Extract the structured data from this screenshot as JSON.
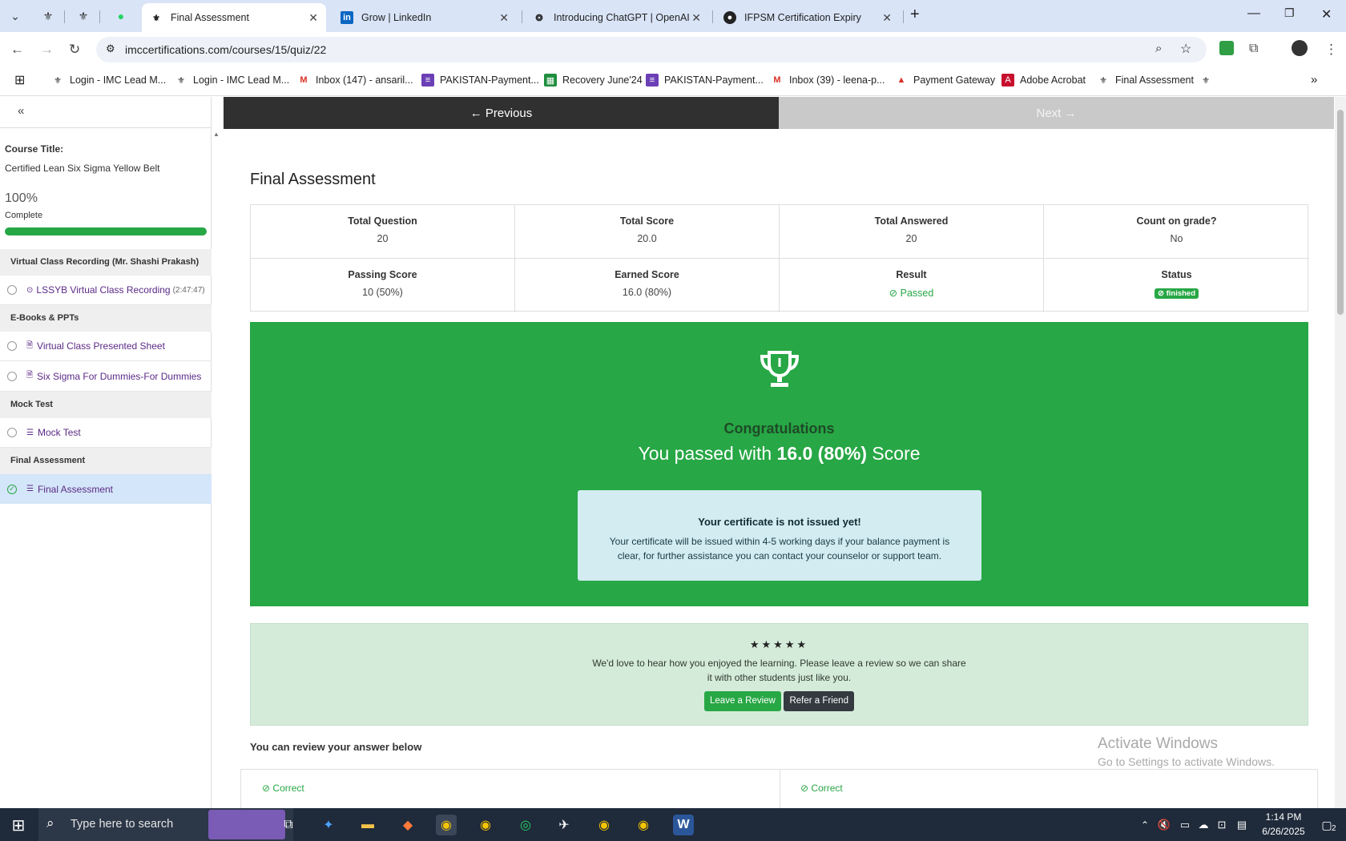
{
  "tabs": [
    {
      "label": "Final Assessment",
      "active": true
    },
    {
      "label": "Grow | LinkedIn"
    },
    {
      "label": "Introducing ChatGPT | OpenAI"
    },
    {
      "label": "IFPSM Certification Expiry"
    }
  ],
  "address": {
    "url": "imccertifications.com/courses/15/quiz/22"
  },
  "bookmarks": [
    "Login - IMC Lead M...",
    "Login - IMC Lead M...",
    "Inbox (147) - ansaril...",
    "PAKISTAN-Payment...",
    "Recovery June'24",
    "PAKISTAN-Payment...",
    "Inbox (39) - leena-p...",
    "Payment Gateway",
    "Adobe Acrobat",
    "Final Assessment"
  ],
  "sidebar": {
    "course_title_label": "Course Title:",
    "course_title": "Certified Lean Six Sigma Yellow Belt",
    "progress_value": "100%",
    "progress_label": "Complete",
    "progress_fraction": 1.0,
    "sections": [
      {
        "title": "Virtual Class Recording (Mr. Shashi Prakash)",
        "items": [
          {
            "label": "LSSYB Virtual Class Recording",
            "duration": "(2:47:47)"
          }
        ]
      },
      {
        "title": "E-Books & PPTs",
        "items": [
          {
            "label": "Virtual Class Presented Sheet"
          },
          {
            "label": "Six Sigma For Dummies-For Dummies"
          }
        ]
      },
      {
        "title": "Mock Test",
        "items": [
          {
            "label": "Mock Test"
          }
        ]
      },
      {
        "title": "Final Assessment",
        "items": [
          {
            "label": "Final Assessment"
          }
        ]
      }
    ]
  },
  "nav": {
    "previous": "← Previous",
    "next": "Next →"
  },
  "page_title": "Final Assessment",
  "stats": {
    "total_question": {
      "label": "Total Question",
      "value": "20"
    },
    "total_score": {
      "label": "Total Score",
      "value": "20.0"
    },
    "total_answered": {
      "label": "Total Answered",
      "value": "20"
    },
    "count_on_grade": {
      "label": "Count on grade?",
      "value": "No"
    },
    "passing_score": {
      "label": "Passing Score",
      "value": "10 (50%)"
    },
    "earned_score": {
      "label": "Earned Score",
      "value": "16.0 (80%)"
    },
    "result": {
      "label": "Result",
      "value": "Passed"
    },
    "status": {
      "label": "Status",
      "value": "finished"
    }
  },
  "congrats": {
    "heading": "Congratulations",
    "line_pre": "You passed with ",
    "line_score": "16.0 (80%)",
    "line_post": " Score",
    "cert_title": "Your certificate is not issued yet!",
    "cert_text": "Your certificate will be issued within 4-5 working days if your balance payment is clear, for further assistance you can contact your counselor or support team."
  },
  "review": {
    "stars": 5,
    "text": "We'd love to hear how you enjoyed the learning. Please leave a review so we can share it with other students just like you.",
    "leave_review": "Leave a Review",
    "refer_friend": "Refer a Friend"
  },
  "answers": {
    "heading": "You can review your answer below",
    "left_status": "Correct",
    "right_status": "Correct"
  },
  "watermark": {
    "title": "Activate Windows",
    "subtitle": "Go to Settings to activate Windows."
  },
  "taskbar": {
    "search_placeholder": "Type here to search",
    "time": "1:14 PM",
    "date": "6/26/2025",
    "notif_count": "2"
  },
  "colors": {
    "green": "#27a745",
    "dark": "#303030",
    "sidebar_active": "#d4e6f9"
  }
}
